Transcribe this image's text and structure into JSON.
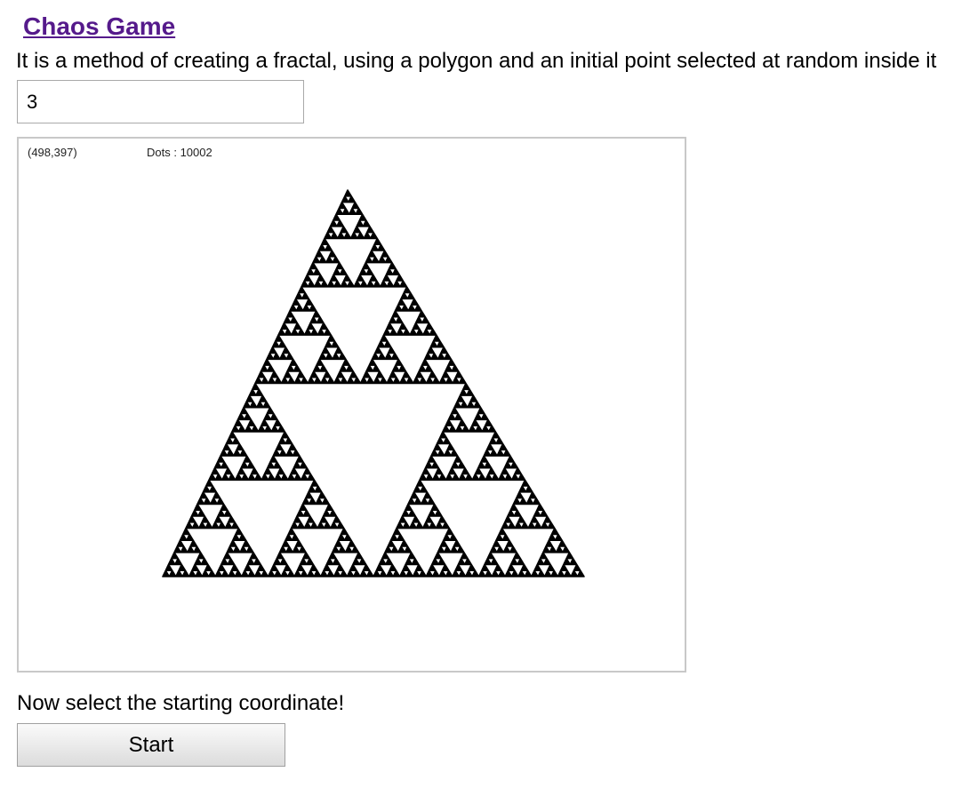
{
  "header": {
    "title": "Chaos Game",
    "description": "It is a method of creating a fractal, using a polygon and an initial point selected at random inside it"
  },
  "controls": {
    "polygon_sides_value": "3"
  },
  "canvas": {
    "coordinate_readout": "(498,397)",
    "dots_readout": "Dots : 10002",
    "dot_count": 10002,
    "fractal": "sierpinski-triangle",
    "fractal_color": "#000000",
    "background_color": "#ffffff"
  },
  "footer": {
    "instruction": "Now select the starting coordinate!",
    "start_label": "Start"
  },
  "colors": {
    "link": "#551a8b",
    "canvas_border": "#c8c8c8",
    "input_border": "#a9a9a9"
  }
}
